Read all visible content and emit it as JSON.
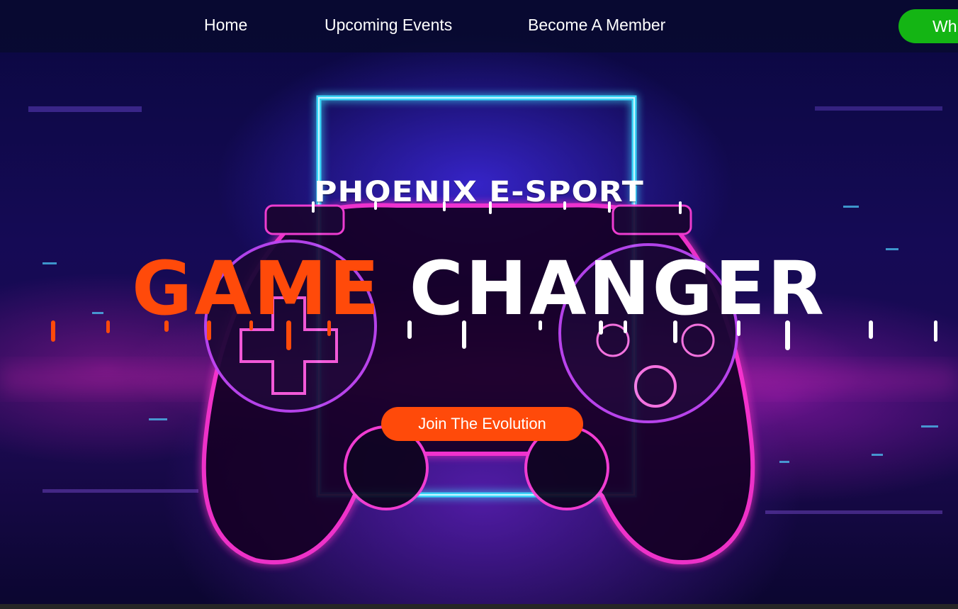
{
  "nav": {
    "links": [
      {
        "label": "Home"
      },
      {
        "label": "Upcoming Events"
      },
      {
        "label": "Become A Member"
      }
    ],
    "cta_label": "Wh"
  },
  "hero": {
    "subtitle": "PHOENIX E-SPORT",
    "headline_part1": "GAME",
    "headline_part2": "CHANGER",
    "button_label": "Join The Evolution"
  },
  "colors": {
    "accent_orange": "#ff4a0a",
    "cta_green": "#14b514",
    "neon_blue": "#3ee0ff",
    "neon_pink": "#ff2fd6"
  },
  "icons": {
    "background": "gamepad-neon-illustration"
  }
}
